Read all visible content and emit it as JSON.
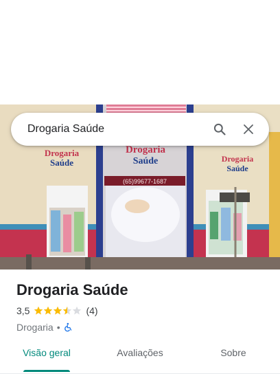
{
  "search": {
    "query": "Drogaria Saúde"
  },
  "photo": {
    "left_sign_line1": "Drogaria",
    "left_sign_line2": "Saúde",
    "center_sign_line1": "Drogaria",
    "center_sign_line2": "Saúde",
    "center_phone": "(65)99677-1687",
    "right_sign_line1": "Drogaria",
    "right_sign_line2": "Saúde"
  },
  "place": {
    "name": "Drogaria Saúde",
    "rating": "3,5",
    "rating_stars": 3.5,
    "review_count": "(4)",
    "category": "Drogaria",
    "separator": "•",
    "accessibility_icon": "wheelchair-icon"
  },
  "tabs": [
    {
      "label": "Visão geral",
      "active": true
    },
    {
      "label": "Avaliações",
      "active": false
    },
    {
      "label": "Sobre",
      "active": false
    }
  ],
  "colors": {
    "accent": "#00897b",
    "star": "#fbbc04",
    "star_empty": "#dadce0",
    "wheelchair": "#1a73e8"
  }
}
